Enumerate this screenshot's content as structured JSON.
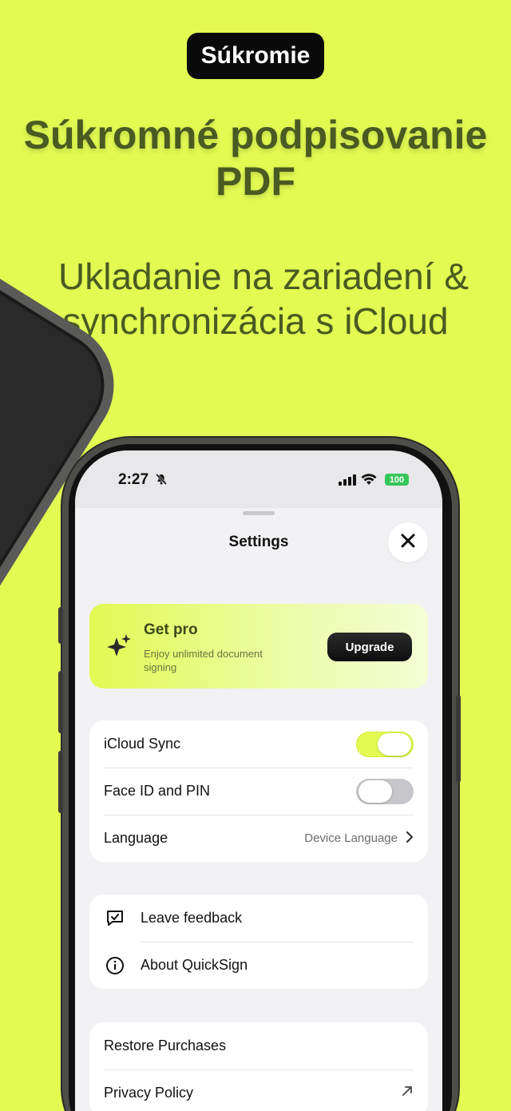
{
  "header": {
    "badge": "Súkromie",
    "headline": "Súkromné podpisovanie PDF",
    "subline_1": "Ukladanie na zariadení  &",
    "subline_2": "synchronizácia s iCloud"
  },
  "status_bar": {
    "time": "2:27",
    "battery": "100"
  },
  "settings": {
    "title": "Settings",
    "pro": {
      "title": "Get pro",
      "description": "Enjoy unlimited document signing",
      "button": "Upgrade"
    },
    "group1": [
      {
        "label": "iCloud Sync",
        "toggle": "on"
      },
      {
        "label": "Face ID and PIN",
        "toggle": "off"
      },
      {
        "label": "Language",
        "value": "Device Language"
      }
    ],
    "group2": [
      {
        "label": "Leave feedback",
        "icon": "feedback-icon"
      },
      {
        "label": "About QuickSign",
        "icon": "info-icon"
      }
    ],
    "group3": [
      {
        "label": "Restore Purchases"
      },
      {
        "label": "Privacy Policy",
        "icon": "external-link-icon"
      }
    ]
  },
  "colors": {
    "background": "#e2fa52",
    "headline": "#4a5a22",
    "toggle_on": "#e2fa52",
    "toggle_off": "#c7c7cb"
  }
}
